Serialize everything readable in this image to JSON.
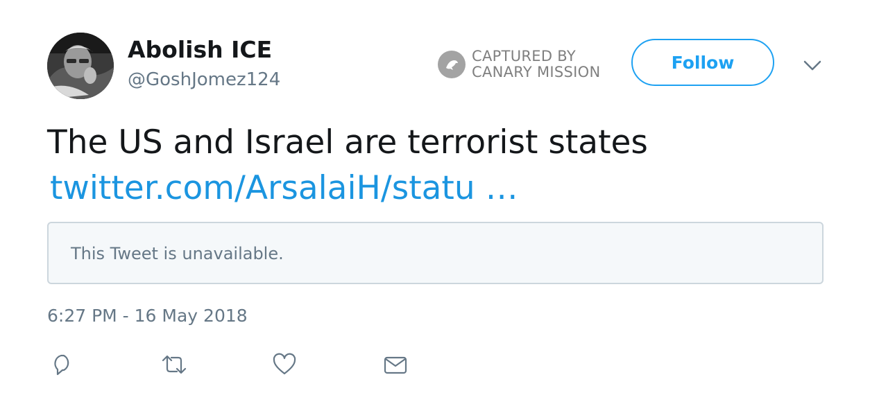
{
  "user": {
    "display_name": "Abolish ICE",
    "handle": "@GoshJomez124"
  },
  "watermark": {
    "line1": "CAPTURED BY",
    "line2": "CANARY MISSION",
    "logo_icon": "canary-bird-icon",
    "color": "#7f7f7f"
  },
  "header": {
    "follow_label": "Follow",
    "more_icon": "chevron-down-icon"
  },
  "tweet": {
    "text": "The US and Israel are terrorist states",
    "link": "twitter.com/ArsalaiH/statu …",
    "quoted_status": "This Tweet is unavailable.",
    "timestamp": "6:27 PM - 16 May 2018"
  },
  "actions": {
    "icons": [
      "reply-icon",
      "retweet-icon",
      "like-icon",
      "direct-message-icon"
    ]
  },
  "colors": {
    "accent": "#1da1f2",
    "link": "#1b95e0",
    "secondary_text": "#657786",
    "primary_text": "#14171a",
    "quote_background": "#f5f8fa",
    "quote_border": "#ccd6dd"
  }
}
